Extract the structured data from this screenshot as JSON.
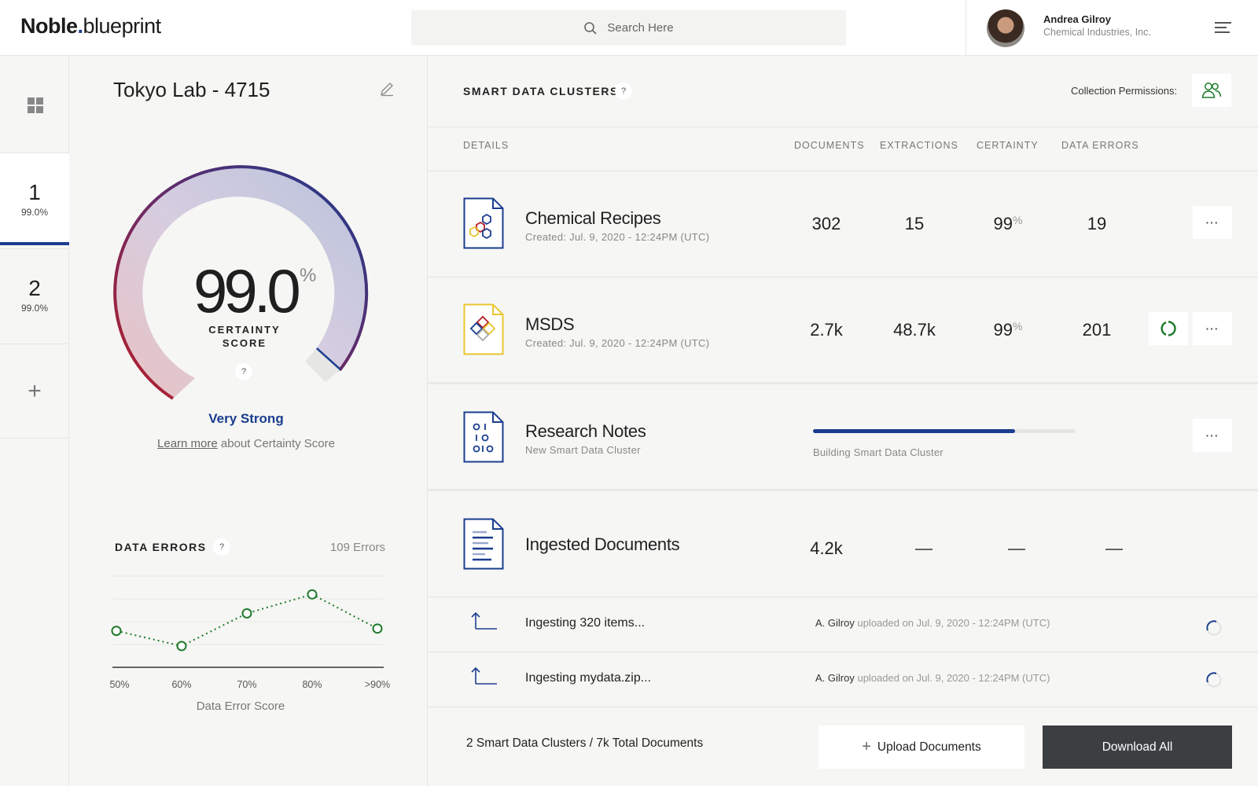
{
  "header": {
    "logo_bold": "Noble",
    "logo_dot": ".",
    "logo_light": "blueprint",
    "search_placeholder": "Search Here",
    "user_name": "Andrea Gilroy",
    "user_company": "Chemical Industries, Inc."
  },
  "rail": {
    "items": [
      {
        "num": "1",
        "pct": "99.0%"
      },
      {
        "num": "2",
        "pct": "99.0%"
      }
    ],
    "add_label": "+"
  },
  "panel": {
    "title": "Tokyo Lab - 4715",
    "score": "99.0",
    "score_unit": "%",
    "score_value": 0.99,
    "score_label": "CERTAINTY SCORE",
    "help": "?",
    "strength": "Very Strong",
    "learn_link": "Learn more",
    "learn_rest": "about Certainty Score",
    "data_errors": {
      "title": "DATA ERRORS",
      "count": "109 Errors",
      "xlabel": "Data Error Score"
    }
  },
  "chart_data": {
    "type": "line",
    "title": "DATA ERRORS",
    "xlabel": "Data Error Score",
    "ylabel": "",
    "categories": [
      "50%",
      "60%",
      "70%",
      "80%",
      ">90%"
    ],
    "values": [
      48,
      28,
      71,
      96,
      51
    ],
    "ylim": [
      0,
      120
    ],
    "grid": true,
    "line_style": "dotted",
    "color": "#1e7a2b"
  },
  "main": {
    "title": "SMART DATA CLUSTERS",
    "help": "?",
    "permissions_label": "Collection Permissions:",
    "columns": [
      "DETAILS",
      "DOCUMENTS",
      "EXTRACTIONS",
      "CERTAINTY",
      "DATA ERRORS"
    ],
    "rows": [
      {
        "name": "Chemical Recipes",
        "sub": "Created: Jul. 9, 2020 - 12:24PM (UTC)",
        "documents": "302",
        "extractions": "15",
        "certainty": "99",
        "certainty_unit": "%",
        "errors": "19"
      },
      {
        "name": "MSDS",
        "sub": "Created: Jul. 9, 2020 - 12:24PM (UTC)",
        "documents": "2.7k",
        "extractions": "48.7k",
        "certainty": "99",
        "certainty_unit": "%",
        "errors": "201"
      }
    ],
    "building": {
      "name": "Research Notes",
      "sub": "New Smart Data Cluster",
      "progress": 0.77,
      "status": "Building Smart Data Cluster"
    },
    "ingested": {
      "name": "Ingested Documents",
      "documents": "4.2k"
    },
    "ingesting": [
      {
        "name": "Ingesting 320 items...",
        "user": "A. Gilroy",
        "meta": "uploaded on Jul. 9, 2020 - 12:24PM (UTC)"
      },
      {
        "name": "Ingesting mydata.zip...",
        "user": "A. Gilroy",
        "meta": "uploaded on Jul. 9, 2020 - 12:24PM (UTC)"
      }
    ],
    "more_label": "···",
    "footer": {
      "summary": "2 Smart Data Clusters / 7k Total Documents",
      "upload_label": "Upload Documents",
      "upload_icon": "+",
      "download_label": "Download All"
    }
  },
  "colors": {
    "accent": "#1a3d8f",
    "gauge_start": "#b5202a",
    "gauge_end": "#1a3d8f",
    "success": "#1e7a2b",
    "msds_icon": "#e9c531"
  }
}
